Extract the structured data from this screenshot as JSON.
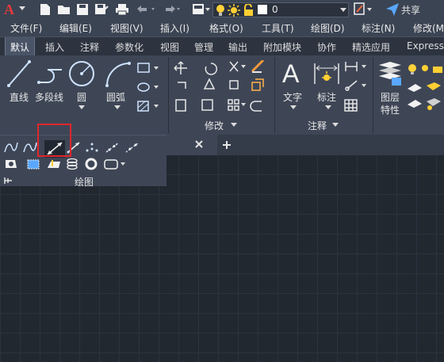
{
  "quick_access": {
    "app_logo": "A",
    "layer_value": "0",
    "share_label": "共享"
  },
  "menu": {
    "items": [
      "文件(F)",
      "编辑(E)",
      "视图(V)",
      "插入(I)",
      "格式(O)",
      "工具(T)",
      "绘图(D)",
      "标注(N)",
      "修改(M)"
    ]
  },
  "ribbon_tabs": {
    "items": [
      "默认",
      "插入",
      "注释",
      "参数化",
      "视图",
      "管理",
      "输出",
      "附加模块",
      "协作",
      "精选应用",
      "Express"
    ]
  },
  "ribbon": {
    "draw": {
      "line_label": "直线",
      "polyline_label": "多段线",
      "circle_label": "圆",
      "arc_label": "圆弧",
      "panel_label": "绘图"
    },
    "modify": {
      "panel_label": "修改"
    },
    "annotation": {
      "text_label": "文字",
      "dimension_label": "标注",
      "panel_label": "注释"
    },
    "layers": {
      "layer_props_label_1": "图层",
      "layer_props_label_2": "特性"
    }
  },
  "colors": {
    "highlight": "#e0262b",
    "accent_blue": "#5aa7ff",
    "logo_red": "#e23a3a"
  }
}
